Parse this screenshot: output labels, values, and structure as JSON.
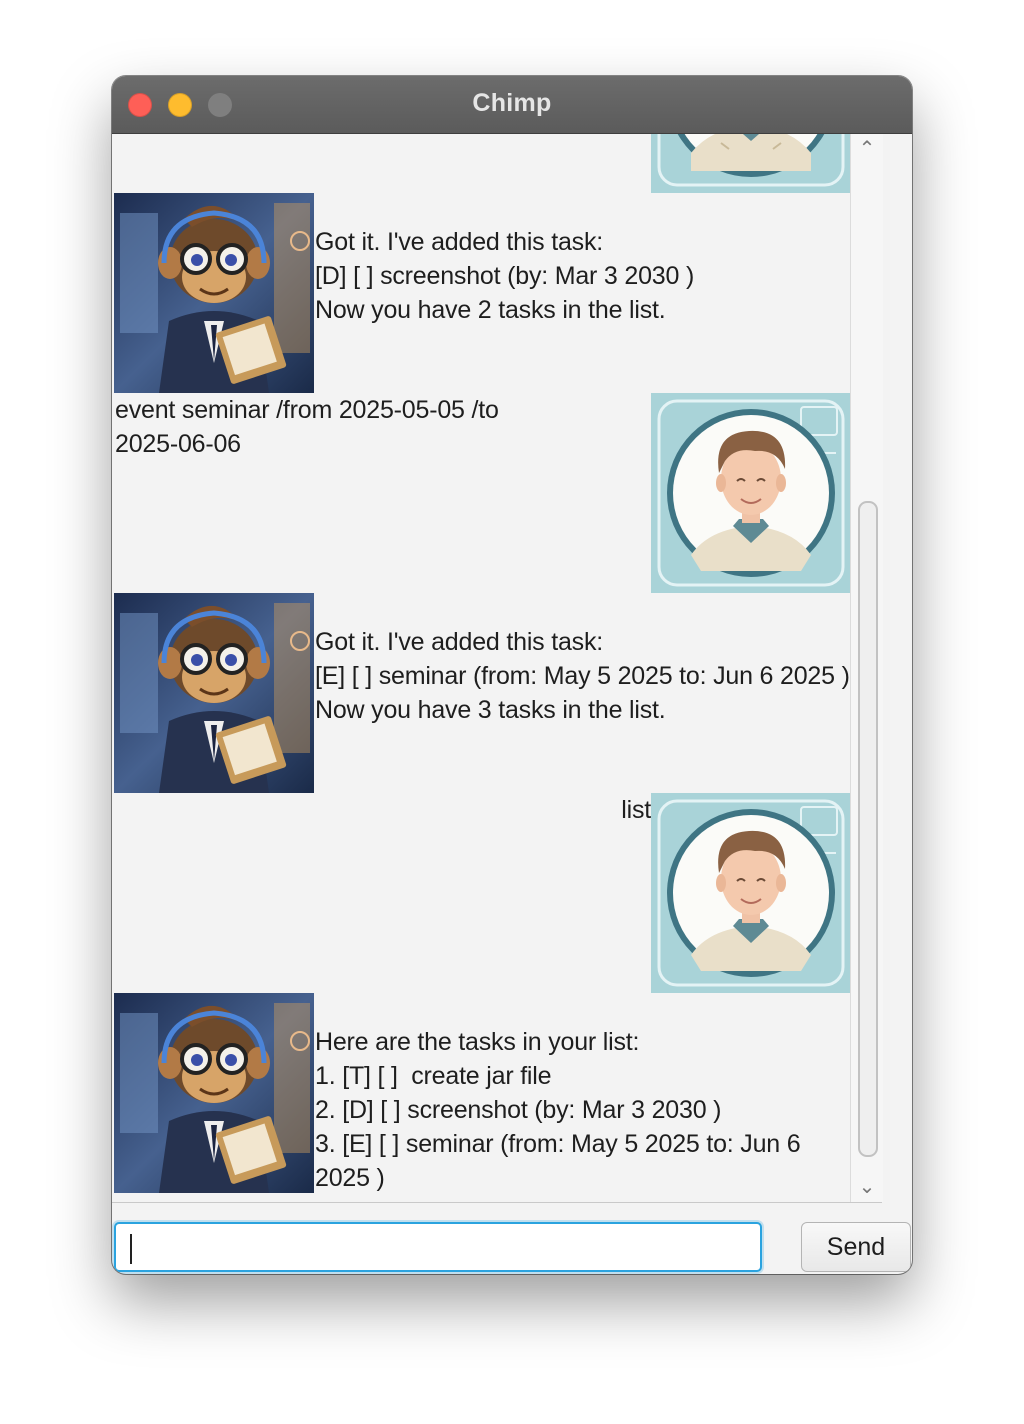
{
  "window": {
    "title": "Chimp"
  },
  "conversation": [
    {
      "speaker": "bot",
      "text": "Got it. I've added this task:\n[D] [ ] screenshot (by: Mar 3 2030 )\nNow you have 2 tasks in the list."
    },
    {
      "speaker": "user",
      "text": "event seminar /from 2025-05-05 /to\n2025-06-06"
    },
    {
      "speaker": "bot",
      "text": "Got it. I've added this task:\n[E] [ ] seminar (from: May 5 2025 to: Jun 6 2025 )\nNow you have 3 tasks in the list."
    },
    {
      "speaker": "user",
      "text": "list"
    },
    {
      "speaker": "bot",
      "text": "Here are the tasks in your list:\n1. [T] [ ]  create jar file\n2. [D] [ ] screenshot (by: Mar 3 2030 )\n3. [E] [ ] seminar (from: May 5 2025 to: Jun 6\n2025 )"
    }
  ],
  "input": {
    "value": "",
    "placeholder": ""
  },
  "send_button": {
    "label": "Send"
  },
  "colors": {
    "close": "#fe5f57",
    "minimize": "#febc2e",
    "focus_ring": "#2aa3df",
    "titlebar": "#616161"
  },
  "icons": {
    "bot_avatar": "monkey-avatar-icon",
    "user_avatar": "user-avatar-icon"
  }
}
